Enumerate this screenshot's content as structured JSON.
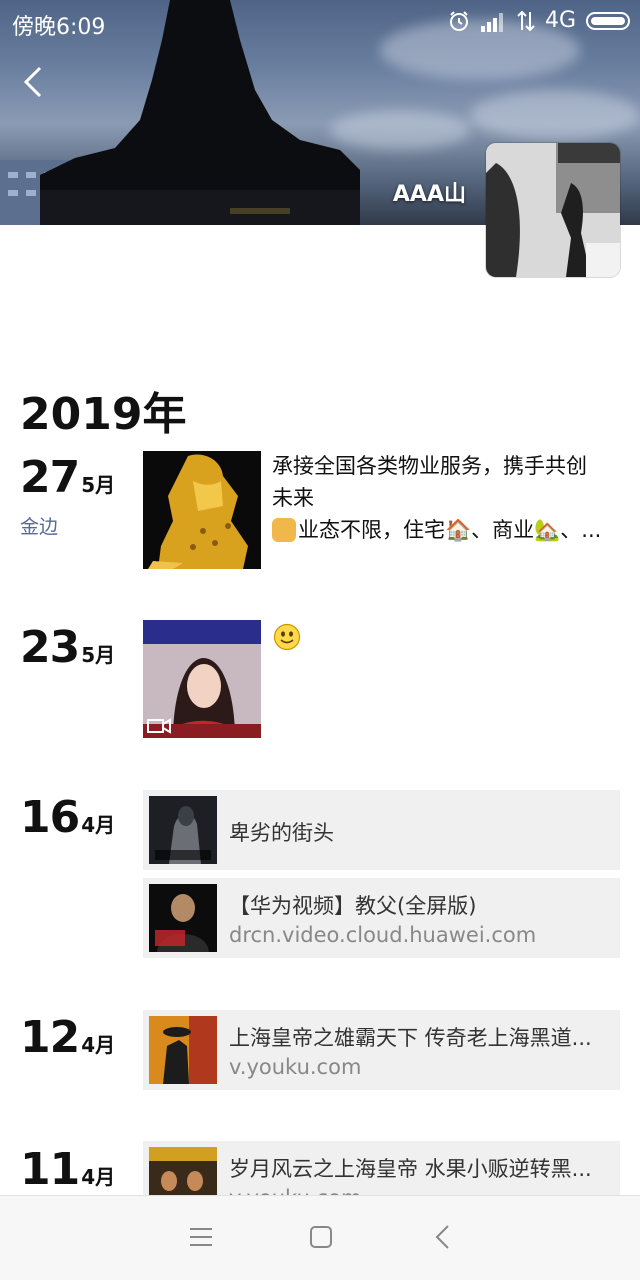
{
  "status_bar": {
    "time": "傍晚6:09",
    "network": "4G",
    "icons": [
      "alarm-icon",
      "signal-icon",
      "data-transfer-icon",
      "battery-icon"
    ]
  },
  "profile": {
    "username": "AAA山",
    "back_icon": "back-arrow-icon"
  },
  "timeline": {
    "year": "2019年",
    "entries": [
      {
        "day": "27",
        "month": "5月",
        "location": "金边",
        "type": "photo",
        "text_line1": "承接全国各类物业服务，携手共创",
        "text_line2": "未来",
        "text_line3": "业态不限，住宅🏠、商业🏡、..."
      },
      {
        "day": "23",
        "month": "5月",
        "type": "video",
        "text_emoji": "smiley-face-icon"
      },
      {
        "day": "16",
        "month": "4月",
        "type": "shares",
        "shares": [
          {
            "title": "卑劣的街头",
            "domain": ""
          },
          {
            "title": "【华为视频】教父(全屏版)",
            "domain": "drcn.video.cloud.huawei.com"
          }
        ]
      },
      {
        "day": "12",
        "month": "4月",
        "type": "shares",
        "shares": [
          {
            "title": "上海皇帝之雄霸天下 传奇老上海黑道...",
            "domain": "v.youku.com"
          }
        ]
      },
      {
        "day": "11",
        "month": "4月",
        "type": "shares",
        "shares": [
          {
            "title": "岁月风云之上海皇帝 水果小贩逆转黑...",
            "domain": "v.youku.com"
          }
        ]
      }
    ]
  },
  "nav_bar": {
    "icons": [
      "menu-icon",
      "home-square-icon",
      "back-triangle-icon"
    ]
  },
  "colors": {
    "link_blue": "#576b95",
    "share_bg": "#f0f0f0",
    "navbar_bg": "#f7f7f7"
  }
}
